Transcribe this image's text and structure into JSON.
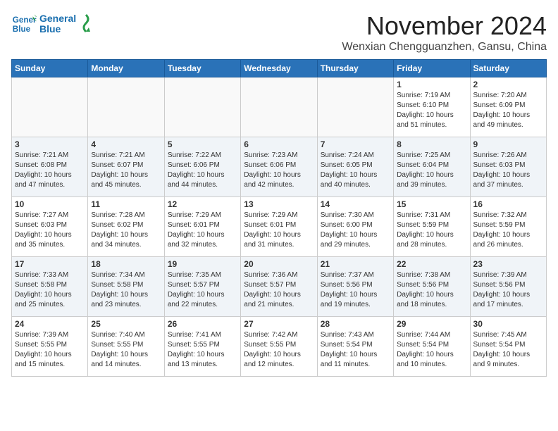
{
  "header": {
    "logo_line1": "General",
    "logo_line2": "Blue",
    "month": "November 2024",
    "location": "Wenxian Chengguanzhen, Gansu, China"
  },
  "days_of_week": [
    "Sunday",
    "Monday",
    "Tuesday",
    "Wednesday",
    "Thursday",
    "Friday",
    "Saturday"
  ],
  "weeks": [
    [
      {
        "day": "",
        "info": ""
      },
      {
        "day": "",
        "info": ""
      },
      {
        "day": "",
        "info": ""
      },
      {
        "day": "",
        "info": ""
      },
      {
        "day": "",
        "info": ""
      },
      {
        "day": "1",
        "info": "Sunrise: 7:19 AM\nSunset: 6:10 PM\nDaylight: 10 hours\nand 51 minutes."
      },
      {
        "day": "2",
        "info": "Sunrise: 7:20 AM\nSunset: 6:09 PM\nDaylight: 10 hours\nand 49 minutes."
      }
    ],
    [
      {
        "day": "3",
        "info": "Sunrise: 7:21 AM\nSunset: 6:08 PM\nDaylight: 10 hours\nand 47 minutes."
      },
      {
        "day": "4",
        "info": "Sunrise: 7:21 AM\nSunset: 6:07 PM\nDaylight: 10 hours\nand 45 minutes."
      },
      {
        "day": "5",
        "info": "Sunrise: 7:22 AM\nSunset: 6:06 PM\nDaylight: 10 hours\nand 44 minutes."
      },
      {
        "day": "6",
        "info": "Sunrise: 7:23 AM\nSunset: 6:06 PM\nDaylight: 10 hours\nand 42 minutes."
      },
      {
        "day": "7",
        "info": "Sunrise: 7:24 AM\nSunset: 6:05 PM\nDaylight: 10 hours\nand 40 minutes."
      },
      {
        "day": "8",
        "info": "Sunrise: 7:25 AM\nSunset: 6:04 PM\nDaylight: 10 hours\nand 39 minutes."
      },
      {
        "day": "9",
        "info": "Sunrise: 7:26 AM\nSunset: 6:03 PM\nDaylight: 10 hours\nand 37 minutes."
      }
    ],
    [
      {
        "day": "10",
        "info": "Sunrise: 7:27 AM\nSunset: 6:03 PM\nDaylight: 10 hours\nand 35 minutes."
      },
      {
        "day": "11",
        "info": "Sunrise: 7:28 AM\nSunset: 6:02 PM\nDaylight: 10 hours\nand 34 minutes."
      },
      {
        "day": "12",
        "info": "Sunrise: 7:29 AM\nSunset: 6:01 PM\nDaylight: 10 hours\nand 32 minutes."
      },
      {
        "day": "13",
        "info": "Sunrise: 7:29 AM\nSunset: 6:01 PM\nDaylight: 10 hours\nand 31 minutes."
      },
      {
        "day": "14",
        "info": "Sunrise: 7:30 AM\nSunset: 6:00 PM\nDaylight: 10 hours\nand 29 minutes."
      },
      {
        "day": "15",
        "info": "Sunrise: 7:31 AM\nSunset: 5:59 PM\nDaylight: 10 hours\nand 28 minutes."
      },
      {
        "day": "16",
        "info": "Sunrise: 7:32 AM\nSunset: 5:59 PM\nDaylight: 10 hours\nand 26 minutes."
      }
    ],
    [
      {
        "day": "17",
        "info": "Sunrise: 7:33 AM\nSunset: 5:58 PM\nDaylight: 10 hours\nand 25 minutes."
      },
      {
        "day": "18",
        "info": "Sunrise: 7:34 AM\nSunset: 5:58 PM\nDaylight: 10 hours\nand 23 minutes."
      },
      {
        "day": "19",
        "info": "Sunrise: 7:35 AM\nSunset: 5:57 PM\nDaylight: 10 hours\nand 22 minutes."
      },
      {
        "day": "20",
        "info": "Sunrise: 7:36 AM\nSunset: 5:57 PM\nDaylight: 10 hours\nand 21 minutes."
      },
      {
        "day": "21",
        "info": "Sunrise: 7:37 AM\nSunset: 5:56 PM\nDaylight: 10 hours\nand 19 minutes."
      },
      {
        "day": "22",
        "info": "Sunrise: 7:38 AM\nSunset: 5:56 PM\nDaylight: 10 hours\nand 18 minutes."
      },
      {
        "day": "23",
        "info": "Sunrise: 7:39 AM\nSunset: 5:56 PM\nDaylight: 10 hours\nand 17 minutes."
      }
    ],
    [
      {
        "day": "24",
        "info": "Sunrise: 7:39 AM\nSunset: 5:55 PM\nDaylight: 10 hours\nand 15 minutes."
      },
      {
        "day": "25",
        "info": "Sunrise: 7:40 AM\nSunset: 5:55 PM\nDaylight: 10 hours\nand 14 minutes."
      },
      {
        "day": "26",
        "info": "Sunrise: 7:41 AM\nSunset: 5:55 PM\nDaylight: 10 hours\nand 13 minutes."
      },
      {
        "day": "27",
        "info": "Sunrise: 7:42 AM\nSunset: 5:55 PM\nDaylight: 10 hours\nand 12 minutes."
      },
      {
        "day": "28",
        "info": "Sunrise: 7:43 AM\nSunset: 5:54 PM\nDaylight: 10 hours\nand 11 minutes."
      },
      {
        "day": "29",
        "info": "Sunrise: 7:44 AM\nSunset: 5:54 PM\nDaylight: 10 hours\nand 10 minutes."
      },
      {
        "day": "30",
        "info": "Sunrise: 7:45 AM\nSunset: 5:54 PM\nDaylight: 10 hours\nand 9 minutes."
      }
    ]
  ]
}
